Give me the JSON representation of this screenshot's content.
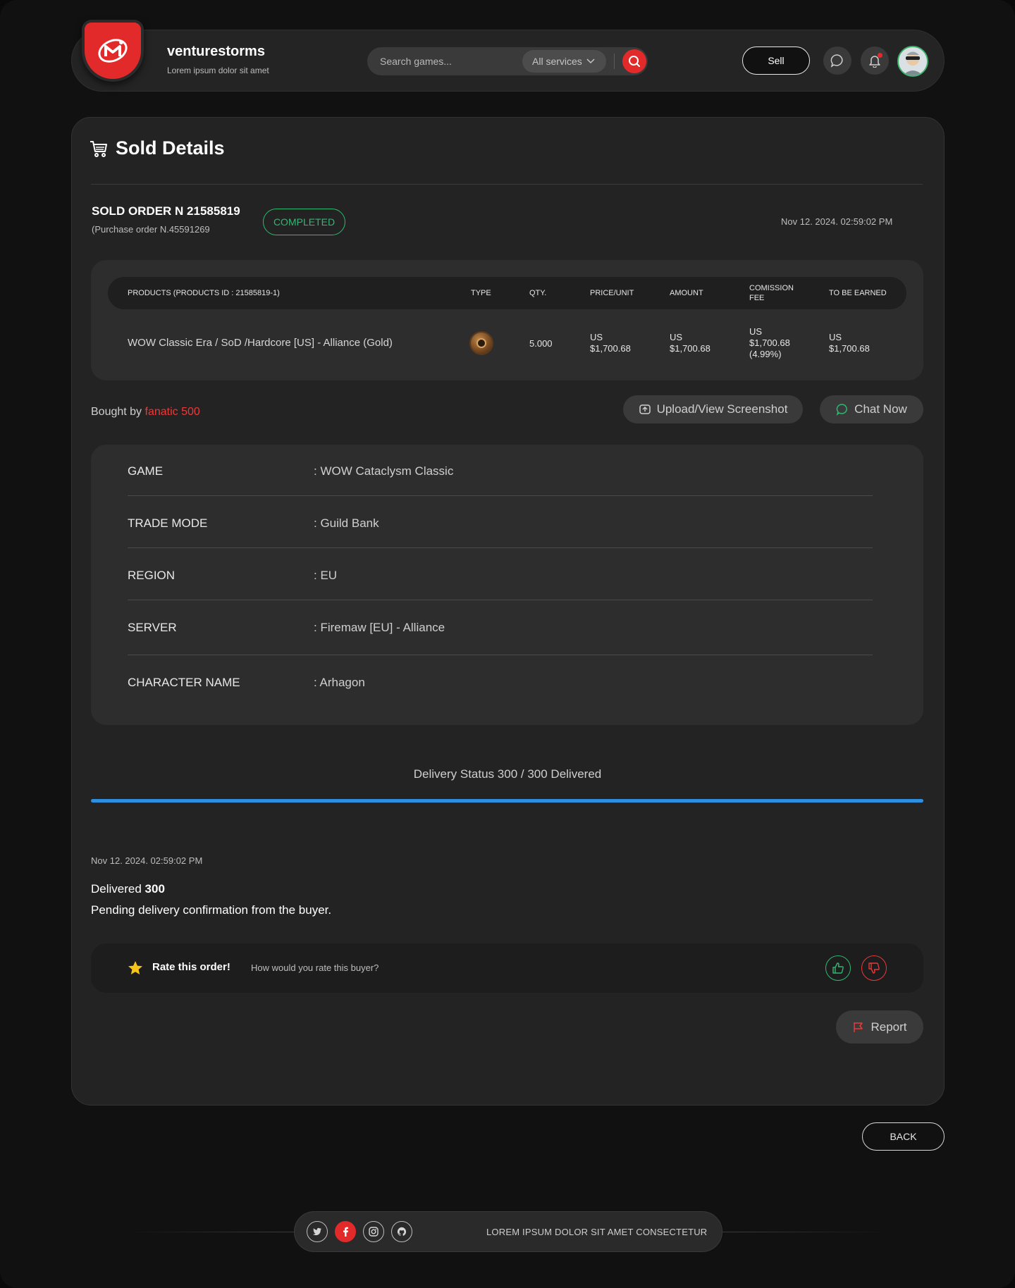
{
  "header": {
    "brand_name": "venturestorms",
    "brand_tagline": "Lorem ipsum dolor sit amet",
    "search_placeholder": "Search games...",
    "service_filter": "All services",
    "sell_label": "Sell",
    "icons": [
      "chat-icon",
      "bell-icon",
      "search-icon"
    ],
    "accent_color": "#e32a2a"
  },
  "page": {
    "title": "Sold Details"
  },
  "order": {
    "number": "SOLD ORDER N 21585819",
    "purchase_order": "(Purchase order N.45591269",
    "status": "COMPLETED",
    "status_color": "#2fb873",
    "date": "Nov  12. 2024.  02:59:02  PM"
  },
  "products_table": {
    "headers": {
      "product": "PRODUCTS (PRODUCTS  ID : 21585819-1)",
      "type": "TYPE",
      "qty": "QTY.",
      "price_unit": "PRICE/UNIT",
      "amount": "AMOUNT",
      "fee_line1": "COMISSION",
      "fee_line2": "FEE",
      "earned": "TO BE EARNED"
    },
    "row": {
      "product": "WOW Classic Era / SoD /Hardcore [US] - Alliance (Gold)",
      "type_icon": "gold-coin-icon",
      "qty": "5.000",
      "price_unit_line1": "US",
      "price_unit_line2": "$1,700.68",
      "amount_line1": "US",
      "amount_line2": "$1,700.68",
      "fee_line1": "US",
      "fee_line2": "$1,700.68",
      "fee_line3": "(4.99%)",
      "earned_line1": "US",
      "earned_line2": "$1,700.68"
    }
  },
  "buyer": {
    "prefix": "Bought by",
    "name": "fanatic 500",
    "upload_label": "Upload/View Screenshot",
    "chat_label": "Chat Now"
  },
  "details": {
    "game_label": "GAME",
    "game_value": ": WOW Cataclysm Classic",
    "trade_label": "TRADE MODE",
    "trade_value": ": Guild Bank",
    "region_label": "REGION",
    "region_value": ": EU",
    "server_label": "SERVER",
    "server_value": ": Firemaw [EU] - Alliance",
    "character_label": "CHARACTER NAME",
    "character_value": ": Arhagon"
  },
  "delivery": {
    "status_text": "Delivery Status 300 / 300 Delivered",
    "delivered": 300,
    "total": 300,
    "progress_fraction": 1.0,
    "progress_color": "#2e8fe0"
  },
  "history": {
    "date": "Nov  12. 2024.  02:59:02  PM",
    "delivered_prefix": "Delivered",
    "delivered_count": "300",
    "pending_text": "Pending delivery confirmation from the buyer."
  },
  "rating": {
    "title": "Rate this order!",
    "question": "How would you rate this buyer?"
  },
  "actions": {
    "report_label": "Report",
    "back_label": "BACK"
  },
  "footer": {
    "text": "LOREM IPSUM DOLOR SIT AMET CONSECTETUR",
    "social_icons": [
      "twitter-icon",
      "facebook-icon",
      "instagram-icon",
      "github-icon"
    ]
  }
}
